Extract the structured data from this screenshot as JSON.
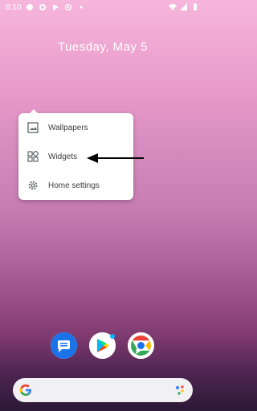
{
  "status_bar": {
    "time": "8:10"
  },
  "home": {
    "date": "Tuesday, May 5"
  },
  "popup_menu": {
    "items": [
      {
        "label": "Wallpapers",
        "icon": "wallpaper-icon"
      },
      {
        "label": "Widgets",
        "icon": "widgets-icon"
      },
      {
        "label": "Home settings",
        "icon": "gear-icon"
      }
    ]
  },
  "dock": {
    "apps": [
      "messages-app-icon",
      "play-store-app-icon",
      "chrome-app-icon"
    ]
  },
  "colors": {
    "menu_bg": "#ffffff",
    "search_bg": "#f1f1f3"
  }
}
